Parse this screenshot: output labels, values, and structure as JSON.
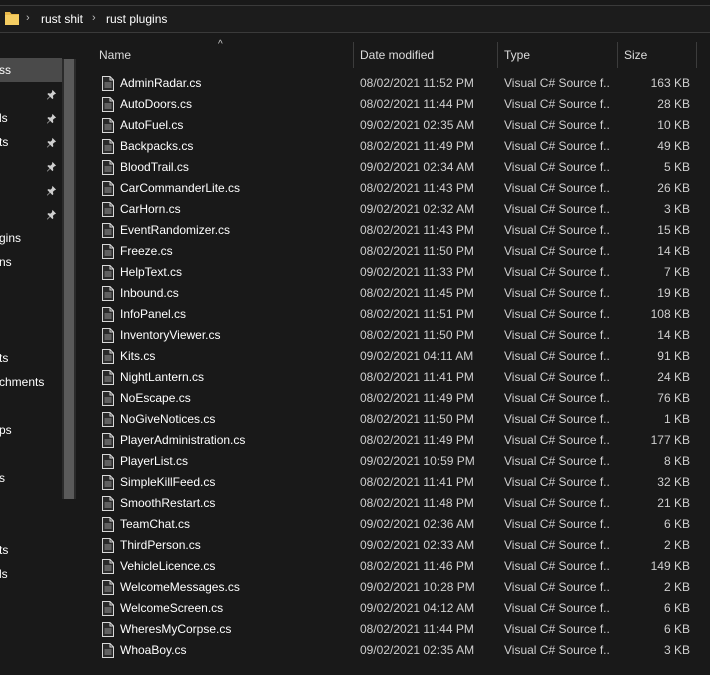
{
  "breadcrumb": [
    "rust shit",
    "rust plugins"
  ],
  "nav": {
    "items": [
      {
        "label": "ss",
        "selected": true,
        "pinned": false
      },
      {
        "label": "",
        "pinned": true
      },
      {
        "label": "ls",
        "pinned": true
      },
      {
        "label": "ts",
        "pinned": true
      },
      {
        "label": "",
        "pinned": true
      },
      {
        "label": "",
        "pinned": true
      },
      {
        "label": "",
        "pinned": true
      },
      {
        "label": "gins",
        "pinned": false
      },
      {
        "label": "ns",
        "pinned": false
      },
      {
        "label": "",
        "pinned": false
      },
      {
        "label": "",
        "pinned": false
      },
      {
        "label": "",
        "pinned": false
      },
      {
        "label": "ts",
        "pinned": false
      },
      {
        "label": "chments",
        "pinned": false
      },
      {
        "label": "",
        "pinned": false
      },
      {
        "label": "ps",
        "pinned": false
      },
      {
        "label": "",
        "pinned": false
      },
      {
        "label": "s",
        "pinned": false
      },
      {
        "label": "",
        "pinned": false
      },
      {
        "label": "",
        "pinned": false
      },
      {
        "label": "ts",
        "pinned": false
      },
      {
        "label": "ls",
        "pinned": false
      }
    ]
  },
  "columns": {
    "name": "Name",
    "date": "Date modified",
    "type": "Type",
    "size": "Size"
  },
  "files": [
    {
      "name": "AdminRadar.cs",
      "date": "08/02/2021 11:52 PM",
      "type": "Visual C# Source f...",
      "size": "163 KB"
    },
    {
      "name": "AutoDoors.cs",
      "date": "08/02/2021 11:44 PM",
      "type": "Visual C# Source f...",
      "size": "28 KB"
    },
    {
      "name": "AutoFuel.cs",
      "date": "09/02/2021 02:35 AM",
      "type": "Visual C# Source f...",
      "size": "10 KB"
    },
    {
      "name": "Backpacks.cs",
      "date": "08/02/2021 11:49 PM",
      "type": "Visual C# Source f...",
      "size": "49 KB"
    },
    {
      "name": "BloodTrail.cs",
      "date": "09/02/2021 02:34 AM",
      "type": "Visual C# Source f...",
      "size": "5 KB"
    },
    {
      "name": "CarCommanderLite.cs",
      "date": "08/02/2021 11:43 PM",
      "type": "Visual C# Source f...",
      "size": "26 KB"
    },
    {
      "name": "CarHorn.cs",
      "date": "09/02/2021 02:32 AM",
      "type": "Visual C# Source f...",
      "size": "3 KB"
    },
    {
      "name": "EventRandomizer.cs",
      "date": "08/02/2021 11:43 PM",
      "type": "Visual C# Source f...",
      "size": "15 KB"
    },
    {
      "name": "Freeze.cs",
      "date": "08/02/2021 11:50 PM",
      "type": "Visual C# Source f...",
      "size": "14 KB"
    },
    {
      "name": "HelpText.cs",
      "date": "09/02/2021 11:33 PM",
      "type": "Visual C# Source f...",
      "size": "7 KB"
    },
    {
      "name": "Inbound.cs",
      "date": "08/02/2021 11:45 PM",
      "type": "Visual C# Source f...",
      "size": "19 KB"
    },
    {
      "name": "InfoPanel.cs",
      "date": "08/02/2021 11:51 PM",
      "type": "Visual C# Source f...",
      "size": "108 KB"
    },
    {
      "name": "InventoryViewer.cs",
      "date": "08/02/2021 11:50 PM",
      "type": "Visual C# Source f...",
      "size": "14 KB"
    },
    {
      "name": "Kits.cs",
      "date": "09/02/2021 04:11 AM",
      "type": "Visual C# Source f...",
      "size": "91 KB"
    },
    {
      "name": "NightLantern.cs",
      "date": "08/02/2021 11:41 PM",
      "type": "Visual C# Source f...",
      "size": "24 KB"
    },
    {
      "name": "NoEscape.cs",
      "date": "08/02/2021 11:49 PM",
      "type": "Visual C# Source f...",
      "size": "76 KB"
    },
    {
      "name": "NoGiveNotices.cs",
      "date": "08/02/2021 11:50 PM",
      "type": "Visual C# Source f...",
      "size": "1 KB"
    },
    {
      "name": "PlayerAdministration.cs",
      "date": "08/02/2021 11:49 PM",
      "type": "Visual C# Source f...",
      "size": "177 KB"
    },
    {
      "name": "PlayerList.cs",
      "date": "09/02/2021 10:59 PM",
      "type": "Visual C# Source f...",
      "size": "8 KB"
    },
    {
      "name": "SimpleKillFeed.cs",
      "date": "08/02/2021 11:41 PM",
      "type": "Visual C# Source f...",
      "size": "32 KB"
    },
    {
      "name": "SmoothRestart.cs",
      "date": "08/02/2021 11:48 PM",
      "type": "Visual C# Source f...",
      "size": "21 KB"
    },
    {
      "name": "TeamChat.cs",
      "date": "09/02/2021 02:36 AM",
      "type": "Visual C# Source f...",
      "size": "6 KB"
    },
    {
      "name": "ThirdPerson.cs",
      "date": "09/02/2021 02:33 AM",
      "type": "Visual C# Source f...",
      "size": "2 KB"
    },
    {
      "name": "VehicleLicence.cs",
      "date": "08/02/2021 11:46 PM",
      "type": "Visual C# Source f...",
      "size": "149 KB"
    },
    {
      "name": "WelcomeMessages.cs",
      "date": "09/02/2021 10:28 PM",
      "type": "Visual C# Source f...",
      "size": "2 KB"
    },
    {
      "name": "WelcomeScreen.cs",
      "date": "09/02/2021 04:12 AM",
      "type": "Visual C# Source f...",
      "size": "6 KB"
    },
    {
      "name": "WheresMyCorpse.cs",
      "date": "08/02/2021 11:44 PM",
      "type": "Visual C# Source f...",
      "size": "6 KB"
    },
    {
      "name": "WhoaBoy.cs",
      "date": "09/02/2021 02:35 AM",
      "type": "Visual C# Source f...",
      "size": "3 KB"
    }
  ],
  "icons": {
    "folder": "folder-icon",
    "file": "cs-file-icon",
    "pin": "pin-icon",
    "sort": "sort-ascending-icon",
    "chevron": "chevron-right-icon"
  },
  "colors": {
    "background": "#191919",
    "selected": "#4a4a4a",
    "folder": "#e8b84a"
  }
}
